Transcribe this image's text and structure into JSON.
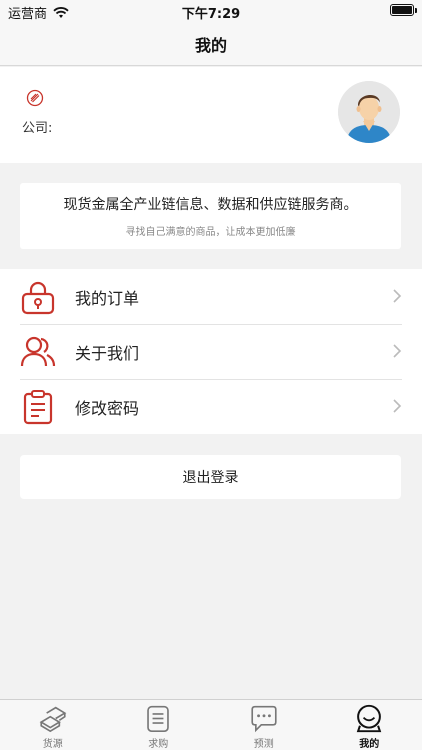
{
  "status_bar": {
    "carrier": "运营商",
    "time": "下午7:29"
  },
  "nav": {
    "title": "我的"
  },
  "profile": {
    "company_label": "公司:"
  },
  "slogan": {
    "main": "现货金属全产业链信息、数据和供应链服务商。",
    "sub": "寻找自己满意的商品，让成本更加低廉"
  },
  "menu": [
    {
      "label": "我的订单",
      "icon": "lock-icon"
    },
    {
      "label": "关于我们",
      "icon": "users-icon"
    },
    {
      "label": "修改密码",
      "icon": "clipboard-icon"
    }
  ],
  "logout": {
    "label": "退出登录"
  },
  "tabs": [
    {
      "label": "货源",
      "icon": "goods-icon",
      "active": false
    },
    {
      "label": "求购",
      "icon": "document-icon",
      "active": false
    },
    {
      "label": "预测",
      "icon": "chat-icon",
      "active": false
    },
    {
      "label": "我的",
      "icon": "profile-icon",
      "active": true
    }
  ],
  "colors": {
    "accent": "#c8352c",
    "background": "#f2f2f2"
  }
}
